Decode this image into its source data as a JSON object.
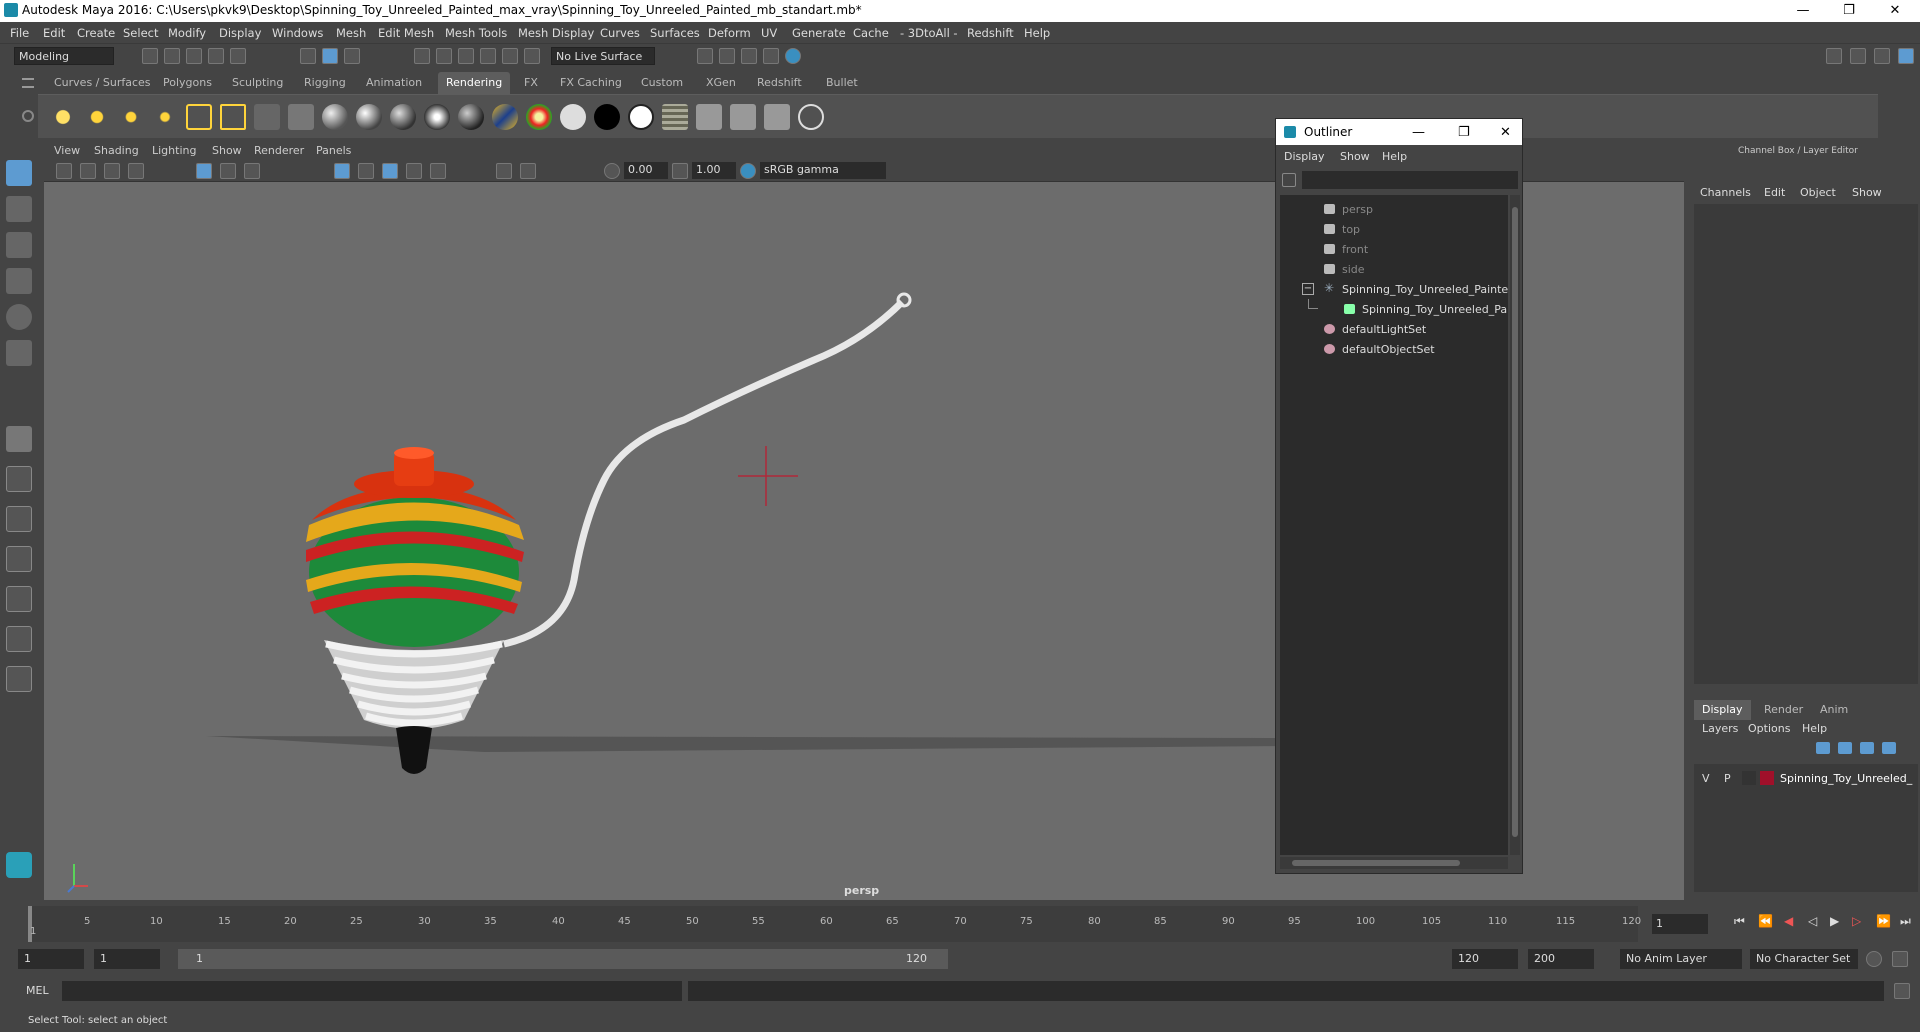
{
  "window": {
    "title": "Autodesk Maya 2016: C:\\Users\\pkvk9\\Desktop\\Spinning_Toy_Unreeled_Painted_max_vray\\Spinning_Toy_Unreeled_Painted_mb_standart.mb*",
    "minimize": "—",
    "restore": "❐",
    "close": "✕"
  },
  "menu": [
    "File",
    "Edit",
    "Create",
    "Select",
    "Modify",
    "Display",
    "Windows",
    "Mesh",
    "Edit Mesh",
    "Mesh Tools",
    "Mesh Display",
    "Curves",
    "Surfaces",
    "Deform",
    "UV",
    "Generate",
    "Cache",
    "- 3DtoAll -",
    "Redshift",
    "Help"
  ],
  "status": {
    "mode": "Modeling",
    "live_surface": "No Live Surface"
  },
  "shelf": {
    "tabs": [
      "Curves / Surfaces",
      "Polygons",
      "Sculpting",
      "Rigging",
      "Animation",
      "Rendering",
      "FX",
      "FX Caching",
      "Custom",
      "XGen",
      "Redshift",
      "Bullet"
    ],
    "active_tab": "Rendering"
  },
  "viewport": {
    "menu": [
      "View",
      "Shading",
      "Lighting",
      "Show",
      "Renderer",
      "Panels"
    ],
    "exposure": "0.00",
    "gamma": "1.00",
    "color_space": "sRGB gamma",
    "camera_label": "persp"
  },
  "outliner": {
    "title": "Outliner",
    "menu": [
      "Display",
      "Show",
      "Help"
    ],
    "items": [
      {
        "label": "persp",
        "type": "camera",
        "dim": true
      },
      {
        "label": "top",
        "type": "camera",
        "dim": true
      },
      {
        "label": "front",
        "type": "camera",
        "dim": true
      },
      {
        "label": "side",
        "type": "camera",
        "dim": true
      },
      {
        "label": "Spinning_Toy_Unreeled_Painted_",
        "type": "group",
        "dim": false
      },
      {
        "label": "Spinning_Toy_Unreeled_Pain",
        "type": "mesh",
        "dim": false
      },
      {
        "label": "defaultLightSet",
        "type": "set",
        "dim": false
      },
      {
        "label": "defaultObjectSet",
        "type": "set",
        "dim": false
      }
    ]
  },
  "channel_box": {
    "title": "Channel Box / Layer Editor",
    "menu": [
      "Channels",
      "Edit",
      "Object",
      "Show"
    ],
    "layer_tabs": [
      "Display",
      "Render",
      "Anim"
    ],
    "active_layer_tab": "Display",
    "layer_menu": [
      "Layers",
      "Options",
      "Help"
    ],
    "layer": {
      "v": "V",
      "p": "P",
      "name": "Spinning_Toy_Unreeled_",
      "color": "#a0102a"
    }
  },
  "timeline": {
    "ticks": [
      "1",
      "5",
      "10",
      "15",
      "20",
      "25",
      "30",
      "35",
      "40",
      "45",
      "50",
      "55",
      "60",
      "65",
      "70",
      "75",
      "80",
      "85",
      "90",
      "95",
      "100",
      "105",
      "110",
      "115",
      "120"
    ],
    "current_frame": "1"
  },
  "range": {
    "start": "1",
    "start_inner": "1",
    "slider_start": "1",
    "slider_end": "120",
    "end_inner": "120",
    "end": "200",
    "anim_layer": "No Anim Layer",
    "character_set": "No Character Set"
  },
  "command": {
    "lang": "MEL",
    "help": "Select Tool: select an object"
  },
  "colors": {
    "accent": "#5d9bd1",
    "top_red": "#d8320f",
    "stripe_green": "#1d8a3a",
    "stripe_yellow": "#e5a81b",
    "string": "#e8e8e8"
  }
}
